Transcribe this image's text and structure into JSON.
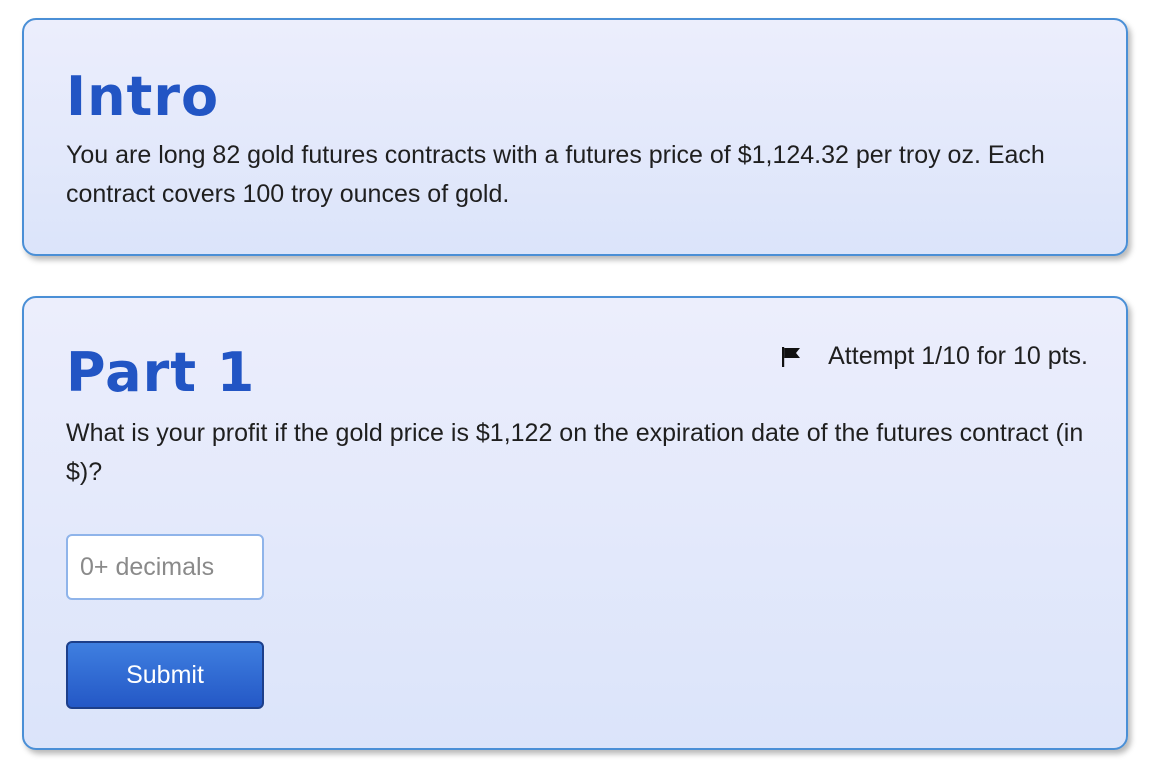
{
  "intro": {
    "title": "Intro",
    "text": "You are long 82 gold futures contracts with a futures price of $1,124.32 per troy oz. Each contract covers 100 troy ounces of gold."
  },
  "part1": {
    "title": "Part 1",
    "attempt_text": "Attempt 1/10 for 10 pts.",
    "flag_icon": "flag-icon",
    "question": "What is your profit if the gold price is $1,122 on the expiration date of the futures contract (in $)?",
    "input_value": "",
    "input_placeholder": "0+ decimals",
    "submit_label": "Submit"
  },
  "colors": {
    "card_border": "#4a8fd6",
    "heading": "#2255c4",
    "submit_bg": "#2d66d2"
  }
}
